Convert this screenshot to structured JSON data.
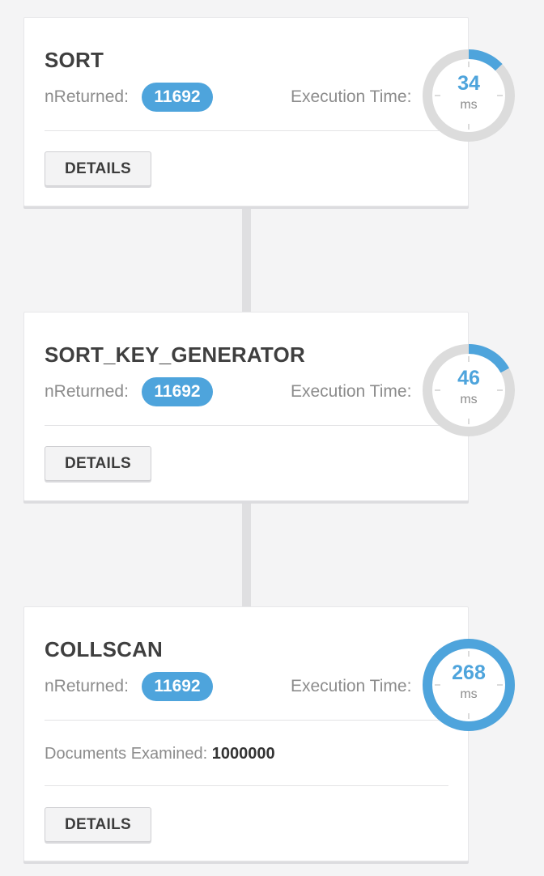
{
  "colors": {
    "accent": "#4ea4dc",
    "ring_track": "#dcdcdc",
    "badge_text": "#ffffff"
  },
  "stages": [
    {
      "name": "SORT",
      "nreturned_label": "nReturned:",
      "nreturned_value": "11692",
      "exec_label": "Execution Time:",
      "exec_value": "34",
      "exec_unit": "ms",
      "exec_fraction": 0.13,
      "details_label": "DETAILS"
    },
    {
      "name": "SORT_KEY_GENERATOR",
      "nreturned_label": "nReturned:",
      "nreturned_value": "11692",
      "exec_label": "Execution Time:",
      "exec_value": "46",
      "exec_unit": "ms",
      "exec_fraction": 0.17,
      "details_label": "DETAILS"
    },
    {
      "name": "COLLSCAN",
      "nreturned_label": "nReturned:",
      "nreturned_value": "11692",
      "exec_label": "Execution Time:",
      "exec_value": "268",
      "exec_unit": "ms",
      "exec_fraction": 1.0,
      "docs_label": "Documents Examined:",
      "docs_value": "1000000",
      "details_label": "DETAILS"
    }
  ]
}
